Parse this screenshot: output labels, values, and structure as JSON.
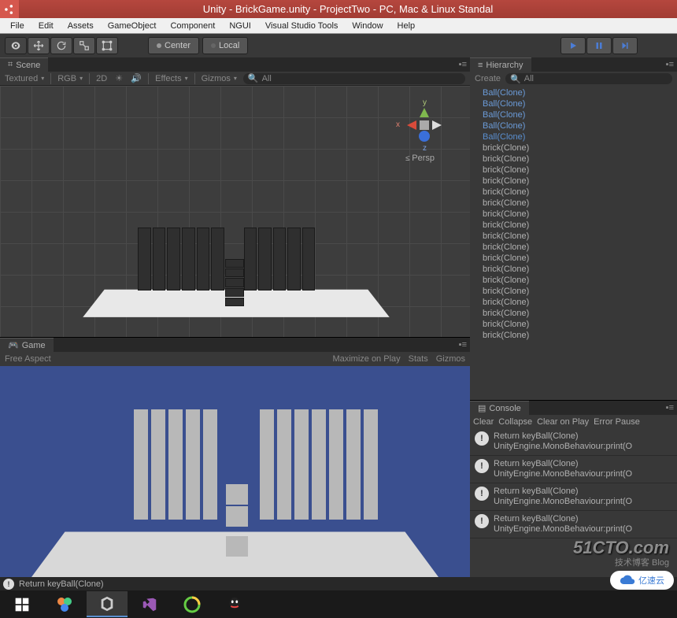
{
  "window": {
    "title": "Unity - BrickGame.unity - ProjectTwo - PC, Mac & Linux Standal"
  },
  "menu": [
    "File",
    "Edit",
    "Assets",
    "GameObject",
    "Component",
    "NGUI",
    "Visual Studio Tools",
    "Window",
    "Help"
  ],
  "pivot": {
    "center": "Center",
    "local": "Local"
  },
  "scene": {
    "tab": "Scene",
    "shading": "Textured",
    "render": "RGB",
    "mode": "2D",
    "effects": "Effects",
    "gizmos": "Gizmos",
    "search": "All",
    "axis_y": "y",
    "axis_x": "x",
    "axis_z": "z",
    "persp": "Persp"
  },
  "game": {
    "tab": "Game",
    "aspect": "Free Aspect",
    "maximize": "Maximize on Play",
    "stats": "Stats",
    "gizmos": "Gizmos"
  },
  "hierarchy": {
    "tab": "Hierarchy",
    "create": "Create",
    "search": "All",
    "items": [
      {
        "label": "Ball(Clone)",
        "cls": "ball"
      },
      {
        "label": "Ball(Clone)",
        "cls": "ball"
      },
      {
        "label": "Ball(Clone)",
        "cls": "ball"
      },
      {
        "label": "Ball(Clone)",
        "cls": "ball"
      },
      {
        "label": "Ball(Clone)",
        "cls": "ball sel"
      },
      {
        "label": "brick(Clone)",
        "cls": ""
      },
      {
        "label": "brick(Clone)",
        "cls": ""
      },
      {
        "label": "brick(Clone)",
        "cls": ""
      },
      {
        "label": "brick(Clone)",
        "cls": ""
      },
      {
        "label": "brick(Clone)",
        "cls": ""
      },
      {
        "label": "brick(Clone)",
        "cls": ""
      },
      {
        "label": "brick(Clone)",
        "cls": ""
      },
      {
        "label": "brick(Clone)",
        "cls": ""
      },
      {
        "label": "brick(Clone)",
        "cls": ""
      },
      {
        "label": "brick(Clone)",
        "cls": ""
      },
      {
        "label": "brick(Clone)",
        "cls": ""
      },
      {
        "label": "brick(Clone)",
        "cls": ""
      },
      {
        "label": "brick(Clone)",
        "cls": ""
      },
      {
        "label": "brick(Clone)",
        "cls": ""
      },
      {
        "label": "brick(Clone)",
        "cls": ""
      },
      {
        "label": "brick(Clone)",
        "cls": ""
      },
      {
        "label": "brick(Clone)",
        "cls": ""
      },
      {
        "label": "brick(Clone)",
        "cls": ""
      }
    ]
  },
  "console": {
    "tab": "Console",
    "clear": "Clear",
    "collapse": "Collapse",
    "cop": "Clear on Play",
    "ep": "Error Pause",
    "logs": [
      {
        "msg": "Return keyBall(Clone)",
        "sub": "UnityEngine.MonoBehaviour:print(O"
      },
      {
        "msg": "Return keyBall(Clone)",
        "sub": "UnityEngine.MonoBehaviour:print(O"
      },
      {
        "msg": "Return keyBall(Clone)",
        "sub": "UnityEngine.MonoBehaviour:print(O"
      },
      {
        "msg": "Return keyBall(Clone)",
        "sub": "UnityEngine.MonoBehaviour:print(O"
      }
    ]
  },
  "status": {
    "msg": "Return keyBall(Clone)"
  },
  "watermark": {
    "main": "51CTO.com",
    "sub": "技术博客  Blog"
  },
  "cloud": "亿速云"
}
